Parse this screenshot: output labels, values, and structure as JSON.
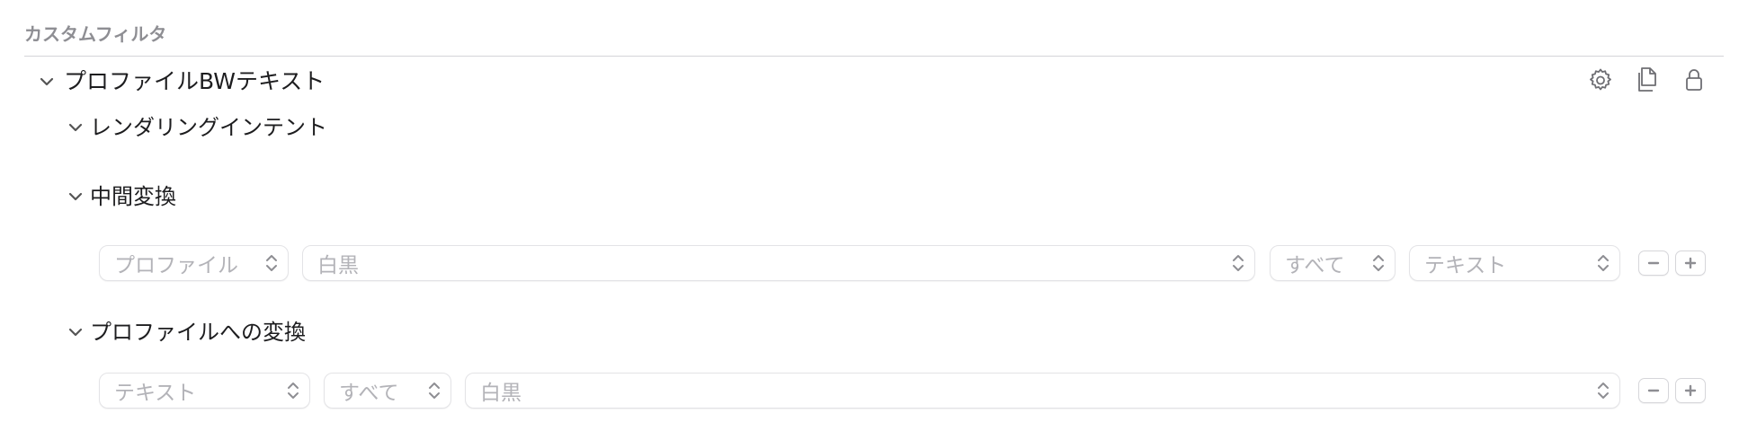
{
  "section": {
    "title": "カスタムフィルタ"
  },
  "profile": {
    "name": "プロファイルBWテキスト",
    "actions": [
      {
        "name": "settings",
        "icon": "gear-icon"
      },
      {
        "name": "duplicate",
        "icon": "copy-document-icon"
      },
      {
        "name": "lock",
        "icon": "lock-icon"
      }
    ]
  },
  "rendering_intent": {
    "label": "レンダリングインテント"
  },
  "intermediate": {
    "label": "中間変換",
    "row": {
      "type": "プロファイル",
      "profile": "白黒",
      "scope": "すべて",
      "target": "テキスト"
    }
  },
  "to_profile": {
    "label": "プロファイルへの変換",
    "row": {
      "target": "テキスト",
      "scope": "すべて",
      "profile": "白黒"
    }
  },
  "colors": {
    "text": "#1d1d1f",
    "muted": "#8e8e93",
    "placeholder": "#b3b3b8",
    "border": "#e3e3e6"
  }
}
